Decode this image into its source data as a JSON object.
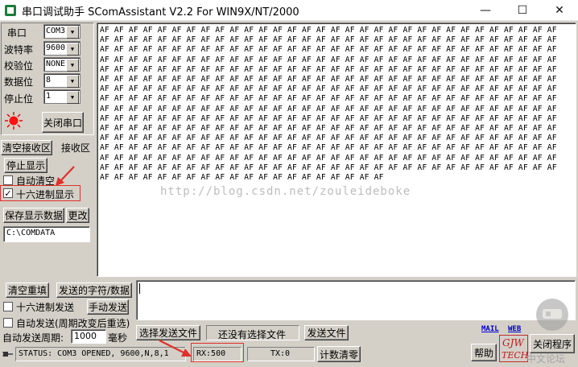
{
  "window": {
    "title": "串口调试助手 SComAssistant V2.2 For WIN9X/NT/2000",
    "minimize_glyph": "—",
    "maximize_glyph": "☐",
    "close_glyph": "✕"
  },
  "settings": {
    "port_label": "串口",
    "port_value": "COM3",
    "baud_label": "波特率",
    "baud_value": "9600",
    "parity_label": "校验位",
    "parity_value": "NONE",
    "databits_label": "数据位",
    "databits_value": "8",
    "stopbits_label": "停止位",
    "stopbits_value": "1",
    "close_port_button": "关闭串口"
  },
  "receive": {
    "clear_button": "清空接收区",
    "area_label": "接收区",
    "stop_display_button": "停止显示",
    "auto_clear_label": "自动清空",
    "hex_display_label": "十六进制显示",
    "hex_display_checked": "✓",
    "save_button": "保存显示数据",
    "change_button": "更改",
    "path_value": "C:\\COMDATA",
    "lines": [
      "AF AF AF AF AF AF AF AF AF AF AF AF AF AF AF AF AF AF AF AF AF AF AF AF AF AF AF AF AF AF AF AF",
      "AF AF AF AF AF AF AF AF AF AF AF AF AF AF AF AF AF AF AF AF AF AF AF AF AF AF AF AF AF AF AF AF",
      "AF AF AF AF AF AF AF AF AF AF AF AF AF AF AF AF AF AF AF AF AF AF AF AF AF AF AF AF AF AF AF AF",
      "AF AF AF AF AF AF AF AF AF AF AF AF AF AF AF AF AF AF AF AF AF AF AF AF AF AF AF AF AF AF AF AF",
      "AF AF AF AF AF AF AF AF AF AF AF AF AF AF AF AF AF AF AF AF AF AF AF AF AF AF AF AF AF AF AF AF",
      "AF AF AF AF AF AF AF AF AF AF AF AF AF AF AF AF AF AF AF AF AF AF AF AF AF AF AF AF AF AF AF AF",
      "AF AF AF AF AF AF AF AF AF AF AF AF AF AF AF AF AF AF AF AF AF AF AF AF AF AF AF AF AF AF AF AF",
      "AF AF AF AF AF AF AF AF AF AF AF AF AF AF AF AF AF AF AF AF AF AF AF AF AF AF AF AF AF AF AF AF",
      "AF AF AF AF AF AF AF AF AF AF AF AF AF AF AF AF AF AF AF AF AF AF AF AF AF AF AF AF AF AF AF AF",
      "AF AF AF AF AF AF AF AF AF AF AF AF AF AF AF AF AF AF AF AF AF AF AF AF AF AF AF AF AF AF AF AF",
      "AF AF AF AF AF AF AF AF AF AF AF AF AF AF AF AF AF AF AF AF AF AF AF AF AF AF AF AF AF AF AF AF",
      "AF AF AF AF AF AF AF AF AF AF AF AF AF AF AF AF AF AF AF AF AF AF AF AF AF AF AF AF AF AF AF AF",
      "AF AF AF AF AF AF AF AF AF AF AF AF AF AF AF AF AF AF AF AF AF AF AF AF AF AF AF AF AF AF AF AF",
      "AF AF AF AF AF AF AF AF AF AF AF AF AF AF AF AF AF AF AF AF AF AF AF AF AF AF AF AF AF AF AF AF",
      "AF AF AF AF AF AF AF AF AF AF AF AF AF AF AF AF AF AF AF AF AF AF AF AF AF AF AF AF AF AF AF AF",
      "AF AF AF AF AF AF AF AF AF AF AF AF AF AF AF AF AF AF AF AF"
    ]
  },
  "watermark": "http://blog.csdn.net/zouleideboke",
  "send": {
    "clear_input_button": "清空重填",
    "send_chars_label": "发送的字符/数据",
    "hex_send_label": "十六进制发送",
    "manual_send_button": "手动发送",
    "auto_send_label": "自动发送(周期改变后重选)",
    "period_label": "自动发送周期:",
    "period_value": "1000",
    "period_unit": "毫秒",
    "select_file_button": "选择发送文件",
    "no_file_label": "还没有选择文件",
    "send_file_button": "发送文件"
  },
  "links": {
    "mail": "MAIL",
    "web": "WEB"
  },
  "status": {
    "status_text": "STATUS: COM3 OPENED, 9600,N,8,1",
    "rx_text": "RX:500",
    "tx_text": "TX:0",
    "reset_count_button": "计数清零",
    "help_button": "帮助",
    "logo_top": "GJW",
    "logo_bottom": "TECH",
    "close_app_button": "关闭程序",
    "forum_watermark": "中文论坛"
  }
}
